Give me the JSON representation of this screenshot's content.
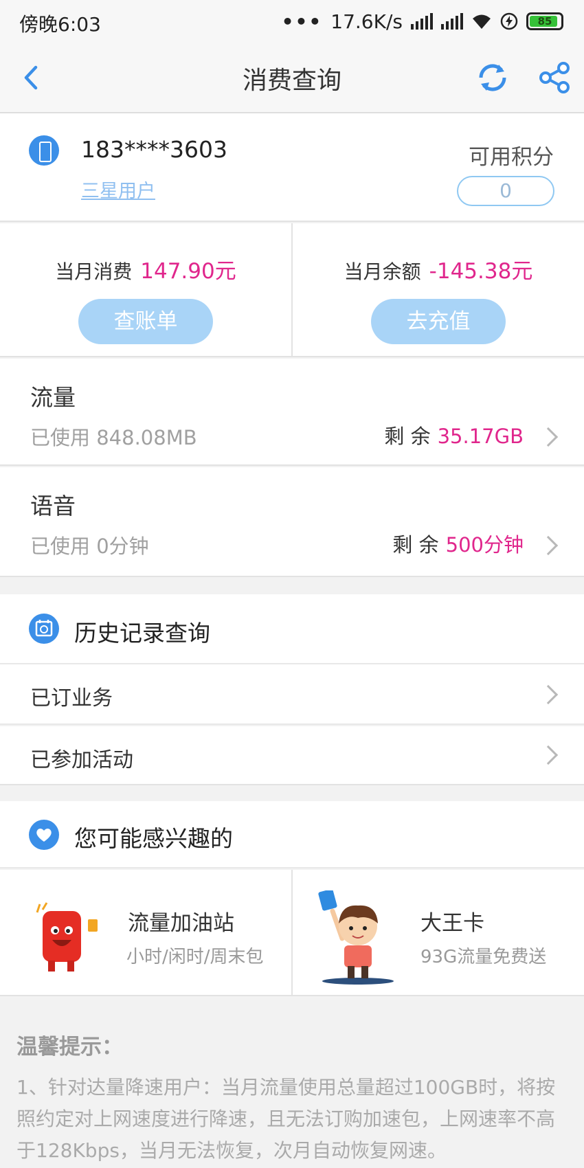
{
  "status_bar": {
    "time": "傍晚6:03",
    "net_speed": "17.6K/s",
    "battery": "85"
  },
  "nav": {
    "title": "消费查询"
  },
  "account": {
    "phone": "183****3603",
    "level": "三星用户",
    "points_label": "可用积分",
    "points_value": "0"
  },
  "spend": {
    "month_spend_label": "当月消费",
    "month_spend_value": "147.90元",
    "bill_button": "查账单",
    "balance_label": "当月余额",
    "balance_value": "-145.38元",
    "recharge_button": "去充值"
  },
  "usage": [
    {
      "name": "流量",
      "used": "已使用 848.08MB",
      "remain_label": "剩 余",
      "remain_value": "35.17GB"
    },
    {
      "name": "语音",
      "used": "已使用 0分钟",
      "remain_label": "剩 余",
      "remain_value": "500分钟"
    }
  ],
  "history": {
    "title": "历史记录查询",
    "items": [
      "已订业务",
      "已参加活动"
    ]
  },
  "interest": {
    "title": "您可能感兴趣的",
    "items": [
      {
        "title": "流量加油站",
        "subtitle": "小时/闲时/周末包"
      },
      {
        "title": "大王卡",
        "subtitle": "93G流量免费送"
      }
    ]
  },
  "tips": {
    "heading": "温馨提示：",
    "body": "1、针对达量降速用户：当月流量使用总量超过100GB时，将按照约定对上网速度进行降速，且无法订购加速包，上网速率不高于128Kbps，当月无法恢复，次月自动恢复网速。"
  },
  "colors": {
    "accent": "#3b8fe8",
    "highlight": "#e0268c",
    "pill": "#a9d4f7"
  }
}
